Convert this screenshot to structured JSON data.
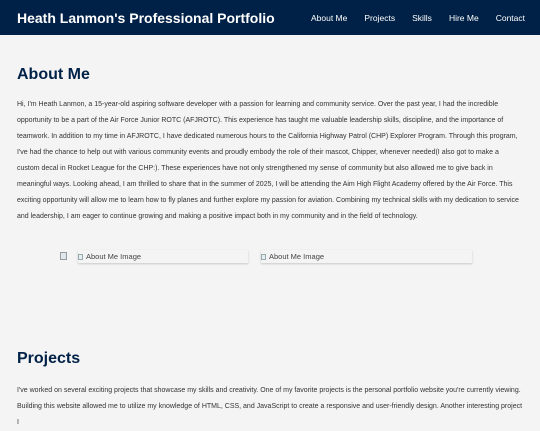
{
  "header": {
    "brand": "Heath Lanmon's Professional Portfolio",
    "nav": [
      "About Me",
      "Projects",
      "Skills",
      "Hire Me",
      "Contact"
    ]
  },
  "about": {
    "title": "About Me",
    "text": "Hi, I'm Heath Lanmon, a 15-year-old aspiring software developer with a passion for learning and community service. Over the past year, I had the incredible opportunity to be a part of the Air Force Junior ROTC (AFJROTC). This experience has taught me valuable leadership skills, discipline, and the importance of teamwork. In addition to my time in AFJROTC, I have dedicated numerous hours to the California Highway Patrol (CHP) Explorer Program. Through this program, I've had the chance to help out with various community events and proudly embody the role of their mascot, Chipper, whenever needed(I also got to make a custom decal in Rocket League for the CHP:). These experiences have not only strengthened my sense of community but also allowed me to give back in meaningful ways. Looking ahead, I am thrilled to share that in the summer of 2025, I will be attending the Aim High Flight Academy offered by the Air Force. This exciting opportunity will allow me to learn how to fly planes and further explore my passion for aviation. Combining my technical skills with my dedication to service and leadership, I am eager to continue growing and making a positive impact both in my community and in the field of technology.",
    "images": [
      "About Me Image",
      "About Me Image"
    ]
  },
  "projects": {
    "title": "Projects",
    "text": "I've worked on several exciting projects that showcase my skills and creativity. One of my favorite projects is the personal portfolio website you're currently viewing. Building this website allowed me to utilize my knowledge of HTML, CSS, and JavaScript to create a responsive and user-friendly design. Another interesting project I"
  },
  "colors": {
    "navbar": "#002147",
    "heading": "#002147",
    "background": "#f4f4f4"
  }
}
